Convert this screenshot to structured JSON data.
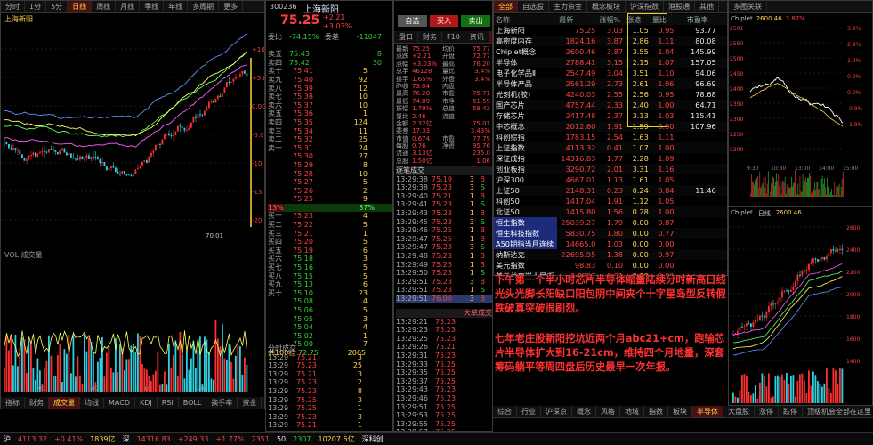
{
  "left_panel": {
    "top_tabs": [
      "分时",
      "1分",
      "5分",
      "日线",
      "周线",
      "月线",
      "季线",
      "年线",
      "多周期",
      "更多"
    ],
    "chart_title": "上海新阳",
    "indicator_bar": "VOL 成交量",
    "bottom_tabs": [
      "指标",
      "财务",
      "成交量",
      "均线",
      "MACD",
      "KDJ",
      "RSI",
      "BOLL",
      "换手率",
      "资金"
    ],
    "price_labels": [
      "+10.00",
      "+5.00",
      "0.00",
      "-5.00",
      "-10.00",
      "-15.00",
      "-20.00"
    ],
    "last_label": "70.01",
    "date_labels": [
      "2/2",
      "3/2",
      "4/1",
      "5/1"
    ]
  },
  "quote_panel": {
    "code": "300236",
    "name": "上海新阳",
    "price": "75.25",
    "change": "+2.21",
    "change_pct": "+3.03%",
    "buttons": [
      "自选",
      "买入",
      "卖出"
    ],
    "info_rows": [
      {
        "k": "委比",
        "v": "-74.15%",
        "k2": "委差",
        "v2": "-11047"
      },
      {
        "k": "",
        "v": "",
        "k2": "",
        "v2": ""
      },
      {
        "k": "卖五",
        "v": "75.43",
        "k2": "",
        "v2": "8"
      },
      {
        "k": "卖四",
        "v": "75.42",
        "k2": "",
        "v2": "30"
      }
    ],
    "sell_levels": [
      {
        "label": "卖十",
        "price": "75.41",
        "vol": "5"
      },
      {
        "label": "卖九",
        "price": "75.40",
        "vol": "92"
      },
      {
        "label": "卖八",
        "price": "75.39",
        "vol": "12"
      },
      {
        "label": "卖七",
        "price": "75.38",
        "vol": "10"
      },
      {
        "label": "卖六",
        "price": "75.37",
        "vol": "10"
      },
      {
        "label": "卖五",
        "price": "75.36",
        "vol": "1"
      },
      {
        "label": "卖四",
        "price": "75.35",
        "vol": "124"
      },
      {
        "label": "卖三",
        "price": "75.34",
        "vol": "11"
      },
      {
        "label": "卖二",
        "price": "75.32",
        "vol": "25"
      },
      {
        "label": "卖一",
        "price": "75.31",
        "vol": "24"
      },
      {
        "label": "",
        "price": "75.30",
        "vol": "27"
      },
      {
        "label": "",
        "price": "75.29",
        "vol": "8"
      },
      {
        "label": "",
        "price": "75.28",
        "vol": "10"
      },
      {
        "label": "",
        "price": "75.27",
        "vol": "5"
      },
      {
        "label": "",
        "price": "75.26",
        "vol": "2"
      },
      {
        "label": "",
        "price": "75.25",
        "vol": "9"
      }
    ],
    "mid_bar": {
      "left": "13%",
      "right": "87%"
    },
    "buy_levels": [
      {
        "label": "买一",
        "price": "75.23",
        "vol": "4"
      },
      {
        "label": "买二",
        "price": "75.22",
        "vol": "5"
      },
      {
        "label": "买三",
        "price": "75.21",
        "vol": "1"
      },
      {
        "label": "买四",
        "price": "75.20",
        "vol": "5"
      },
      {
        "label": "买五",
        "price": "75.19",
        "vol": "6"
      },
      {
        "label": "买六",
        "price": "75.18",
        "vol": "3"
      },
      {
        "label": "买七",
        "price": "75.16",
        "vol": "5"
      },
      {
        "label": "买八",
        "price": "75.15",
        "vol": "5"
      },
      {
        "label": "买九",
        "price": "75.13",
        "vol": "6"
      },
      {
        "label": "买十",
        "price": "75.10",
        "vol": "23"
      },
      {
        "label": "",
        "price": "75.08",
        "vol": "4"
      },
      {
        "label": "",
        "price": "75.06",
        "vol": "5"
      },
      {
        "label": "",
        "price": "75.05",
        "vol": "3"
      },
      {
        "label": "",
        "price": "75.04",
        "vol": "4"
      },
      {
        "label": "",
        "price": "75.02",
        "vol": "1"
      },
      {
        "label": "",
        "price": "75.00",
        "vol": "7"
      }
    ],
    "footer_label": "共100档",
    "footer_price": "72.75",
    "footer_vol": "2065",
    "ticks_title": "分时成交",
    "ticks": [
      {
        "t": "13:29",
        "p": "75.21",
        "v": "3"
      },
      {
        "t": "13:29",
        "p": "75.23",
        "v": "25"
      },
      {
        "t": "13:29",
        "p": "75.21",
        "v": "3"
      },
      {
        "t": "13:29",
        "p": "75.23",
        "v": "2"
      },
      {
        "t": "13:29",
        "p": "75.23",
        "v": "8"
      },
      {
        "t": "13:29",
        "p": "75.25",
        "v": "3"
      },
      {
        "t": "13:29",
        "p": "75.25",
        "v": "1"
      },
      {
        "t": "13:29",
        "p": "75.23",
        "v": "3"
      },
      {
        "t": "13:29",
        "p": "75.21",
        "v": "1"
      },
      {
        "t": "13:29",
        "p": "75.21",
        "v": "1"
      }
    ]
  },
  "stats_panel": {
    "tabs": [
      "盘口",
      "财务",
      "F10",
      "资讯",
      "统计"
    ],
    "rows": [
      {
        "k": "最新",
        "v": "75.25",
        "k2": "均价",
        "v2": "75.77"
      },
      {
        "k": "涨跌",
        "v": "+2.21",
        "k2": "开盘",
        "v2": "72.77"
      },
      {
        "k": "涨幅",
        "v": "+3.03%",
        "k2": "最高",
        "v2": "76.20"
      },
      {
        "k": "总手",
        "v": "46128",
        "k2": "量比",
        "v2": "3.4%"
      },
      {
        "k": "换手",
        "v": "1.65%",
        "k2": "外盘",
        "v2": "3.4%"
      },
      {
        "k": "昨收",
        "v": "73.04",
        "k2": "内盘",
        "v2": ""
      },
      {
        "k": "最高",
        "v": "76.20",
        "k2": "市盈",
        "v2": "75.71"
      },
      {
        "k": "最低",
        "v": "74.89",
        "k2": "市净",
        "v2": "61.59"
      },
      {
        "k": "振幅",
        "v": "1.79%",
        "k2": "总值",
        "v2": "58.43"
      },
      {
        "k": "量比",
        "v": "2.46",
        "k2": "流值",
        "v2": ""
      },
      {
        "k": "金额",
        "v": "2.32亿",
        "k2": "",
        "v2": "75.01"
      },
      {
        "k": "委差",
        "v": "17.33",
        "k2": "",
        "v2": "3.43%"
      },
      {
        "k": "市值",
        "v": "0.674",
        "k2": "市盈",
        "v2": "77.79"
      },
      {
        "k": "每股",
        "v": "0.76",
        "k2": "净资",
        "v2": "95.76"
      },
      {
        "k": "流通",
        "v": "3.13亿",
        "k2": "",
        "v2": "235.0"
      },
      {
        "k": "总股",
        "v": "1.50亿",
        "k2": "",
        "v2": "1.06"
      }
    ],
    "ticks_title": "逐笔成交",
    "ticks": [
      {
        "t": "13:29:38",
        "p": "75.19",
        "v": "3",
        "s": "B"
      },
      {
        "t": "13:29:38",
        "p": "75.23",
        "v": "3",
        "s": "S"
      },
      {
        "t": "13:29:40",
        "p": "75.21",
        "v": "1",
        "s": "B"
      },
      {
        "t": "13:29:41",
        "p": "75.23",
        "v": "1",
        "s": "S"
      },
      {
        "t": "13:29:43",
        "p": "75.23",
        "v": "1",
        "s": "B"
      },
      {
        "t": "13:29:45",
        "p": "75.23",
        "v": "3",
        "s": "S"
      },
      {
        "t": "13:29:46",
        "p": "75.25",
        "v": "1",
        "s": "B"
      },
      {
        "t": "13:29:47",
        "p": "75.25",
        "v": "1",
        "s": "B"
      },
      {
        "t": "13:29:47",
        "p": "75.23",
        "v": "3",
        "s": "S"
      },
      {
        "t": "13:29:48",
        "p": "75.23",
        "v": "1",
        "s": "B"
      },
      {
        "t": "13:29:49",
        "p": "75.25",
        "v": "1",
        "s": "B"
      },
      {
        "t": "13:29:50",
        "p": "75.23",
        "v": "1",
        "s": "S"
      },
      {
        "t": "13:29:51",
        "p": "75.23",
        "v": "3",
        "s": "B"
      },
      {
        "t": "13:29:51",
        "p": "75.23",
        "v": "1",
        "s": "S"
      },
      {
        "t": "13:29:51",
        "p": "76.00",
        "v": "3",
        "s": "B"
      }
    ],
    "ticks2_title": "大单成交",
    "ticks2": [
      {
        "t": "13:29:21",
        "p": "75.23"
      },
      {
        "t": "13:29:23",
        "p": "75.23"
      },
      {
        "t": "13:29:25",
        "p": "75.23"
      },
      {
        "t": "13:29:26",
        "p": "75.21"
      },
      {
        "t": "13:29:31",
        "p": "75.23"
      },
      {
        "t": "13:29:33",
        "p": "75.25"
      },
      {
        "t": "13:29:35",
        "p": "75.25"
      },
      {
        "t": "13:29:37",
        "p": "75.25"
      },
      {
        "t": "13:29:43",
        "p": "75.23"
      },
      {
        "t": "13:29:46",
        "p": "75.23"
      },
      {
        "t": "13:29:51",
        "p": "75.25"
      },
      {
        "t": "13:29:53",
        "p": "75.25"
      },
      {
        "t": "13:29:55",
        "p": "75.25"
      },
      {
        "t": "13:29:57",
        "p": "75.25"
      }
    ]
  },
  "watchlist": {
    "tabs": [
      "全部",
      "自选股",
      "主力资金",
      "概念板块",
      "沪深指数",
      "港股通",
      "其他"
    ],
    "headers": [
      "名称",
      "最新",
      "涨幅%",
      "涨速",
      "量比",
      "",
      "市盈率",
      ""
    ],
    "rows": [
      {
        "name": "上海新阳",
        "price": "75.25",
        "pct": "3.03",
        "a": "1.05",
        "b": "0.95",
        "c": "",
        "d": "93.77"
      },
      {
        "name": "高密度内存",
        "price": "1824.16",
        "pct": "3.87",
        "a": "2.86",
        "b": "1.11",
        "c": "",
        "d": "80.08"
      },
      {
        "name": "Chiplet概念",
        "price": "2600.46",
        "pct": "3.87",
        "a": "3.55",
        "b": "1.04",
        "c": "",
        "d": "145.99"
      },
      {
        "name": "半导体",
        "price": "2788.41",
        "pct": "3.15",
        "a": "2.15",
        "b": "1.07",
        "c": "",
        "d": "157.05"
      },
      {
        "name": "电子化学品Ⅱ",
        "price": "2547.49",
        "pct": "3.04",
        "a": "3.51",
        "b": "1.10",
        "c": "",
        "d": "94.06"
      },
      {
        "name": "半导体产品",
        "price": "2561.29",
        "pct": "2.73",
        "a": "2.61",
        "b": "1.06",
        "c": "",
        "d": "96.69"
      },
      {
        "name": "光刻机(胶)",
        "price": "4240.03",
        "pct": "2.55",
        "a": "2.56",
        "b": "0.95",
        "c": "",
        "d": "78.68"
      },
      {
        "name": "国产芯片",
        "price": "4757.44",
        "pct": "2.33",
        "a": "2.40",
        "b": "1.00",
        "c": "",
        "d": "64.71"
      },
      {
        "name": "存储芯片",
        "price": "2417.48",
        "pct": "2.37",
        "a": "3.13",
        "b": "1.03",
        "c": "",
        "d": "115.41"
      },
      {
        "name": "中芯概念",
        "price": "2012.60",
        "pct": "1.91",
        "a": "1.59",
        "b": "0.90",
        "c": "",
        "d": "107.96"
      },
      {
        "name": "科创综指",
        "price": "1783.15",
        "pct": "2.54",
        "a": "1.63",
        "b": "1.11",
        "c": "",
        "d": ""
      },
      {
        "name": "上证指数",
        "price": "4113.32",
        "pct": "0.41",
        "a": "1.07",
        "b": "1.00",
        "c": "",
        "d": ""
      },
      {
        "name": "深证成指",
        "price": "14316.83",
        "pct": "1.77",
        "a": "2.28",
        "b": "1.09",
        "c": "",
        "d": ""
      },
      {
        "name": "创业板指",
        "price": "3290.72",
        "pct": "2.01",
        "a": "3.31",
        "b": "1.16",
        "c": "",
        "d": ""
      },
      {
        "name": "沪深300",
        "price": "4667.01",
        "pct": "1.13",
        "a": "1.61",
        "b": "1.05",
        "c": "",
        "d": ""
      },
      {
        "name": "上证50",
        "price": "2148.31",
        "pct": "0.23",
        "a": "0.24",
        "b": "0.84",
        "c": "",
        "d": "11.46"
      },
      {
        "name": "科创50",
        "price": "1417.04",
        "pct": "1.91",
        "a": "1.12",
        "b": "1.05",
        "c": "",
        "d": ""
      },
      {
        "name": "北证50",
        "price": "1415.80",
        "pct": "1.56",
        "a": "0.28",
        "b": "1.00",
        "c": "",
        "d": ""
      },
      {
        "name": "恒生指数",
        "price": "25039.27",
        "pct": "1.79",
        "a": "0.00",
        "b": "0.87",
        "c": "",
        "d": ""
      },
      {
        "name": "恒生科技指数",
        "price": "5830.75",
        "pct": "1.80",
        "a": "0.00",
        "b": "0.77",
        "c": "",
        "d": ""
      },
      {
        "name": "A50期指当月连续",
        "price": "14665.0",
        "pct": "1.03",
        "a": "0.00",
        "b": "0.00",
        "c": "",
        "d": ""
      },
      {
        "name": "纳斯达克",
        "price": "22695.95",
        "pct": "1.38",
        "a": "0.00",
        "b": "0.97",
        "c": "",
        "d": ""
      },
      {
        "name": "美元指数",
        "price": "98.83",
        "pct": "0.10",
        "a": "0.00",
        "b": "0.00",
        "c": "",
        "d": ""
      },
      {
        "name": "美元兑离岸人民币",
        "price": "6.8887",
        "pct": "0.01",
        "a": "0.00",
        "b": "0.00",
        "c": "",
        "d": ""
      }
    ],
    "bottom_tabs": [
      "综合",
      "行业",
      "沪深京",
      "概念",
      "风格",
      "地域",
      "指数",
      "板块",
      "半导体",
      "大盘股",
      "涨停",
      "跌停",
      "顶级机会全部在这里"
    ]
  },
  "mini_chart": {
    "title": "Chiplet",
    "value": "2600.46",
    "pct": "3.87%",
    "y_labels": [
      "2501",
      "2550",
      "2500",
      "2450",
      "2400",
      "2350",
      "2300",
      "2250",
      "2200"
    ],
    "r_labels": [
      "3.9%",
      "2.9%",
      "1.9%",
      "0.9%",
      "0.0%",
      "-0.9%",
      "-1.9%"
    ],
    "times": [
      "9:30",
      "10:30",
      "13:00",
      "14:00",
      "15:00"
    ]
  },
  "kline": {
    "title": "Chiplet",
    "period": "日线",
    "value": "2600.46",
    "right_labels": [
      "2600",
      "2400",
      "2200",
      "2000",
      "1800",
      "1600",
      "1400"
    ]
  },
  "annotation": {
    "p1": "下午第一个半小时芯片半导体缩量陆续分时新高日线光头光脚长阳缺口阳包阴中间夹个十字星岛型反转假跌破真突破很刷烈。",
    "p2": "七年老庄股新阳挖坑近两个月abc21+cm，跑输芯片半导体扩大到16-21cm，维持四个月地量，深套筹码躺平等周四盘后历史最早一次年报。"
  },
  "status": {
    "items": [
      {
        "t": "沪",
        "c": "white"
      },
      {
        "t": "4113.32",
        "c": "red"
      },
      {
        "t": "+0.41%",
        "c": "red"
      },
      {
        "t": "1839亿",
        "c": "yellow"
      },
      {
        "t": "深",
        "c": "white"
      },
      {
        "t": "14316.83",
        "c": "red"
      },
      {
        "t": "+249.33",
        "c": "red"
      },
      {
        "t": "+1.77%",
        "c": "red"
      },
      {
        "t": "2351",
        "c": "red"
      },
      {
        "t": "50",
        "c": "white"
      },
      {
        "t": "2307",
        "c": "green"
      },
      {
        "t": "10207.6亿",
        "c": "yellow"
      },
      {
        "t": "深科创",
        "c": "white"
      }
    ]
  },
  "colors": {
    "up": "#ff4040",
    "down": "#30d030",
    "accent": "#ffd24a",
    "bg": "#000000"
  }
}
